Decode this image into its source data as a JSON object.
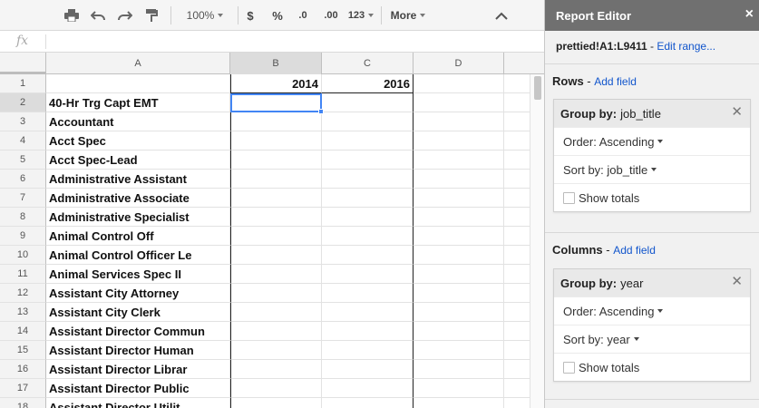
{
  "toolbar": {
    "zoom": "100%",
    "currency": "$",
    "percent": "%",
    "dec_decrease": ".0",
    "dec_increase": ".00",
    "format": "123",
    "more": "More"
  },
  "formula_bar": {
    "fx": "fx",
    "value": ""
  },
  "grid": {
    "columns": [
      "A",
      "B",
      "C",
      "D"
    ],
    "rows": [
      {
        "num": "1",
        "a": "",
        "b": "2014",
        "c": "2016"
      },
      {
        "num": "2",
        "a": "40-Hr Trg Capt EMT",
        "b": "",
        "c": ""
      },
      {
        "num": "3",
        "a": "Accountant",
        "b": "",
        "c": ""
      },
      {
        "num": "4",
        "a": "Acct Spec",
        "b": "",
        "c": ""
      },
      {
        "num": "5",
        "a": "Acct Spec-Lead",
        "b": "",
        "c": ""
      },
      {
        "num": "6",
        "a": "Administrative Assistant",
        "b": "",
        "c": ""
      },
      {
        "num": "7",
        "a": "Administrative Associate",
        "b": "",
        "c": ""
      },
      {
        "num": "8",
        "a": "Administrative Specialist",
        "b": "",
        "c": ""
      },
      {
        "num": "9",
        "a": "Animal Control Off",
        "b": "",
        "c": ""
      },
      {
        "num": "10",
        "a": "Animal Control Officer Le",
        "b": "",
        "c": ""
      },
      {
        "num": "11",
        "a": "Animal Services Spec II",
        "b": "",
        "c": ""
      },
      {
        "num": "12",
        "a": "Assistant City Attorney",
        "b": "",
        "c": ""
      },
      {
        "num": "13",
        "a": "Assistant City Clerk",
        "b": "",
        "c": ""
      },
      {
        "num": "14",
        "a": "Assistant Director Commun",
        "b": "",
        "c": ""
      },
      {
        "num": "15",
        "a": "Assistant Director Human",
        "b": "",
        "c": ""
      },
      {
        "num": "16",
        "a": "Assistant Director Librar",
        "b": "",
        "c": ""
      },
      {
        "num": "17",
        "a": "Assistant Director Public",
        "b": "",
        "c": ""
      },
      {
        "num": "18",
        "a": "Assistant Director Utilit",
        "b": "",
        "c": ""
      }
    ]
  },
  "report_editor": {
    "title": "Report Editor",
    "close": "×",
    "range": "prettied!A1:L9411",
    "range_sep": " - ",
    "edit_range": "Edit range...",
    "rows": {
      "label": "Rows",
      "sep": " - ",
      "add_field": "Add field",
      "group_label": "Group by:",
      "group_value": "job_title",
      "order": "Order: Ascending",
      "sort": "Sort by: job_title",
      "show_totals": "Show totals"
    },
    "columns": {
      "label": "Columns",
      "sep": " - ",
      "add_field": "Add field",
      "group_label": "Group by:",
      "group_value": "year",
      "order": "Order: Ascending",
      "sort": "Sort by: year",
      "show_totals": "Show totals"
    }
  }
}
